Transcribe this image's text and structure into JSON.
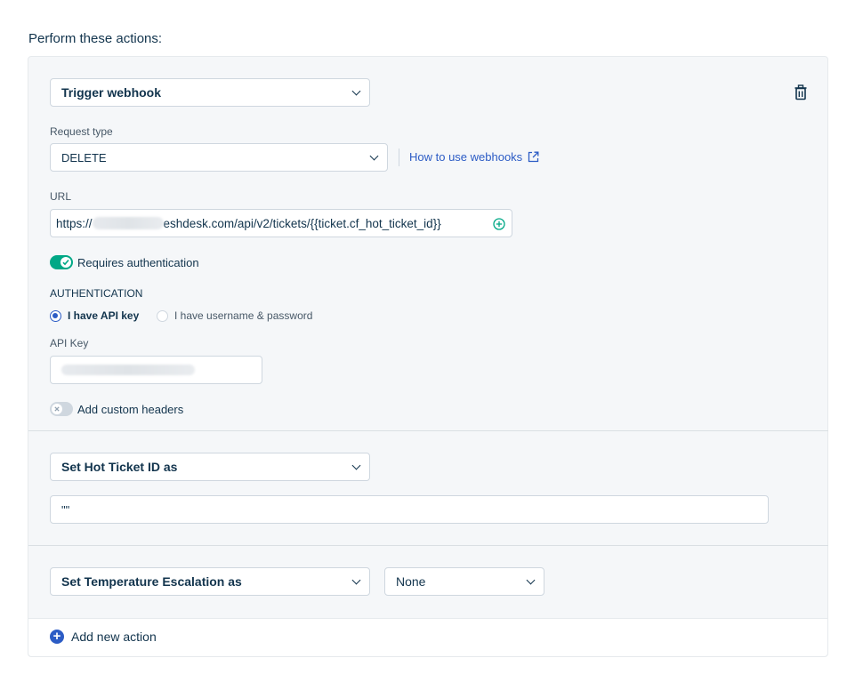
{
  "heading": "Perform these actions:",
  "actions": {
    "webhook": {
      "action_select": "Trigger webhook",
      "request_type_label": "Request type",
      "request_type_value": "DELETE",
      "help_link": "How to use webhooks",
      "url_label": "URL",
      "url_prefix": "https://",
      "url_suffix": "eshdesk.com/api/v2/tickets/{{ticket.cf_hot_ticket_id}}",
      "requires_auth_label": "Requires authentication",
      "auth_heading": "AUTHENTICATION",
      "auth_option_api_key": "I have API key",
      "auth_option_userpass": "I have username & password",
      "api_key_label": "API Key",
      "custom_headers_label": "Add custom headers"
    },
    "hot_ticket": {
      "action_select": "Set Hot Ticket ID as",
      "value": "\"\""
    },
    "temperature": {
      "action_select": "Set Temperature Escalation as",
      "value_select": "None"
    }
  },
  "add_action_label": "Add new action",
  "colors": {
    "link": "#2c5cc5",
    "toggle_on": "#00a886",
    "text": "#12344d"
  }
}
